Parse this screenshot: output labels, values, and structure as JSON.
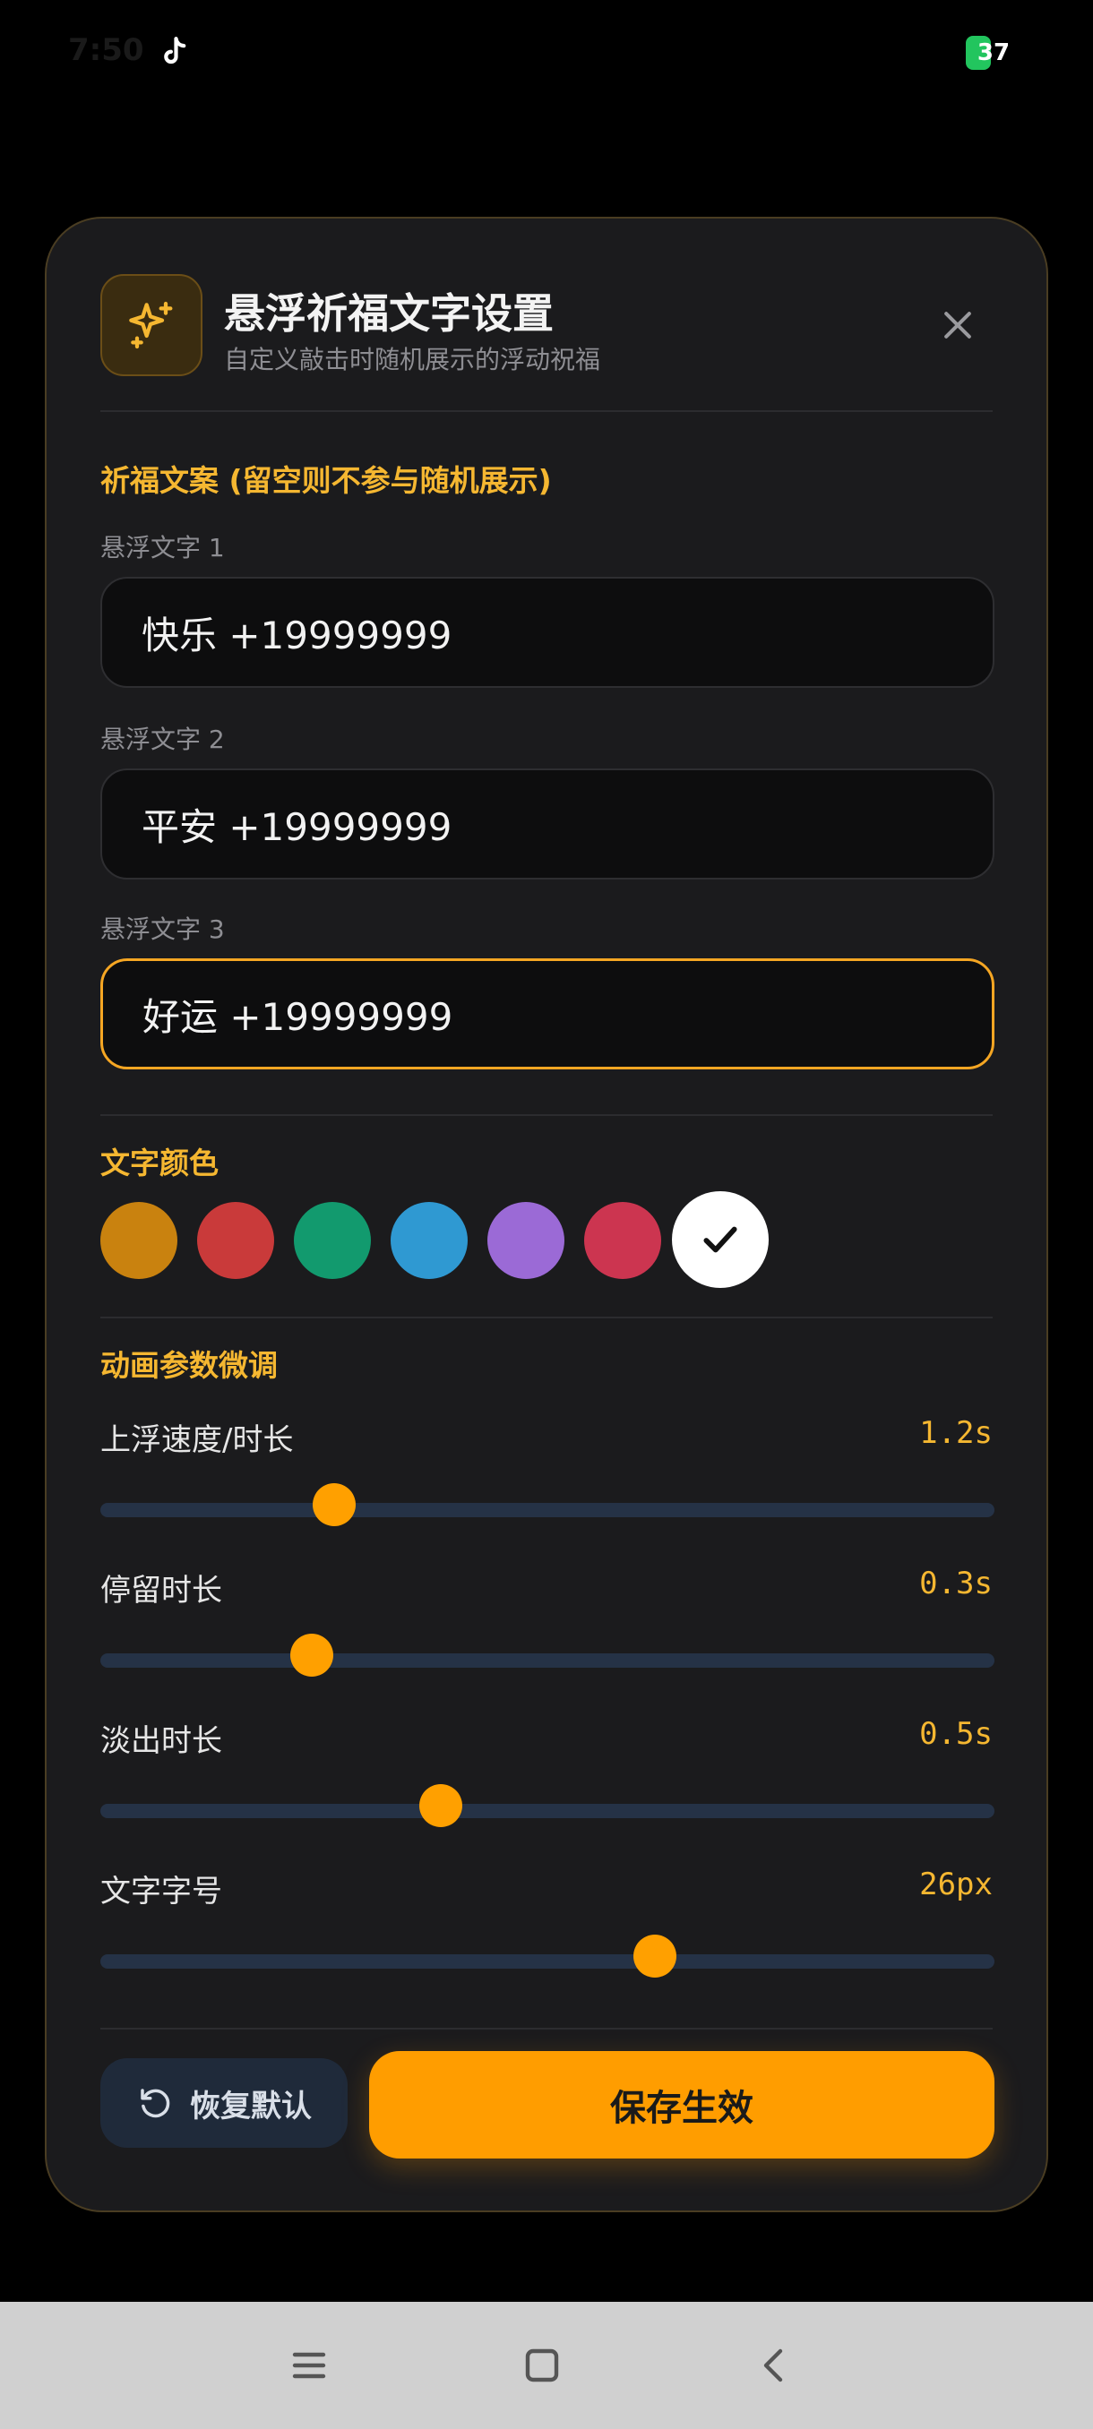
{
  "status_bar": {
    "time": "7:50",
    "battery": "37"
  },
  "dialog": {
    "title": "悬浮祈福文字设置",
    "subtitle": "自定义敲击时随机展示的浮动祝福",
    "close_icon": "close-icon",
    "header_icon": "sparkles-icon"
  },
  "texts_section": {
    "title": "祈福文案 (留空则不参与随机展示)",
    "fields": [
      {
        "label": "悬浮文字 1",
        "value": "快乐 +19999999"
      },
      {
        "label": "悬浮文字 2",
        "value": "平安 +19999999"
      },
      {
        "label": "悬浮文字 3",
        "value": "好运 +19999999"
      }
    ]
  },
  "color_section": {
    "title": "文字颜色",
    "swatches": [
      "#c9820f",
      "#c93a3a",
      "#129a6e",
      "#2f99d2",
      "#9b6ad6",
      "#cc3550",
      "#ffffff"
    ],
    "selected_index": 6
  },
  "anim_section": {
    "title": "动画参数微调",
    "sliders": [
      {
        "label": "上浮速度/时长",
        "value": "1.2s",
        "fraction": 0.262
      },
      {
        "label": "停留时长",
        "value": "0.3s",
        "fraction": 0.236
      },
      {
        "label": "淡出时长",
        "value": "0.5s",
        "fraction": 0.381
      },
      {
        "label": "文字字号",
        "value": "26px",
        "fraction": 0.62
      }
    ]
  },
  "footer": {
    "reset_label": "恢复默认",
    "save_label": "保存生效"
  },
  "nav": {
    "menu_icon": "menu-icon",
    "home_icon": "home-icon",
    "back_icon": "back-icon"
  }
}
